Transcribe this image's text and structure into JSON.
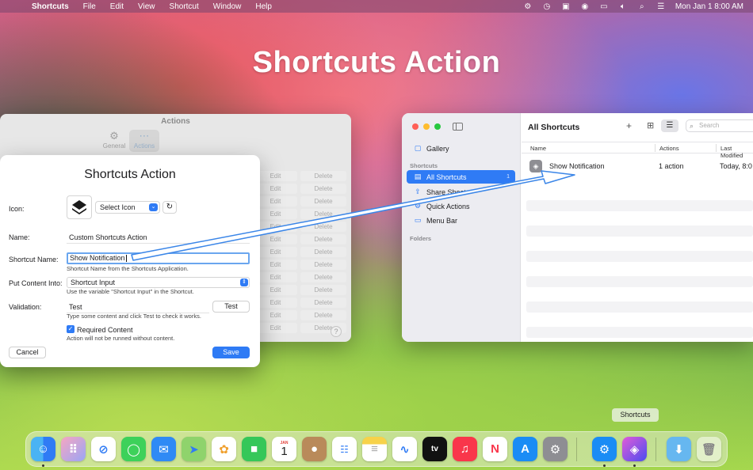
{
  "menubar": {
    "app_name": "Shortcuts",
    "items": [
      "File",
      "Edit",
      "View",
      "Shortcut",
      "Window",
      "Help"
    ],
    "clock": "Mon Jan 1  8:00 AM"
  },
  "overlay_title": "Shortcuts Action",
  "settings_window": {
    "title": "Actions",
    "tabs": [
      "General",
      "Actions"
    ],
    "edit_label": "Edit",
    "delete_label": "Delete",
    "help": "?"
  },
  "dialog": {
    "title": "Shortcuts Action",
    "icon_label": "Icon:",
    "select_icon": "Select Icon",
    "name_label": "Name:",
    "name_value": "Custom Shortcuts Action",
    "shortcut_name_label": "Shortcut Name:",
    "shortcut_name_value": "Show Notification",
    "shortcut_name_hint": "Shortcut Name from the Shortcuts Application.",
    "put_content_label": "Put Content Into:",
    "put_content_value": "Shortcut Input",
    "put_content_hint": "Use the variable \"Shortcut Input\" in the Shortcut.",
    "validation_label": "Validation:",
    "validation_value": "Test",
    "test_button": "Test",
    "validation_hint": "Type some content and click Test to check it works.",
    "required_label": "Required Content",
    "required_hint": "Action will not be runned without content.",
    "cancel_button": "Cancel",
    "save_button": "Save"
  },
  "shortcuts_app": {
    "sidebar": {
      "gallery": "Gallery",
      "section_shortcuts": "Shortcuts",
      "items": [
        {
          "label": "All Shortcuts",
          "count": "1"
        },
        {
          "label": "Share Sheet"
        },
        {
          "label": "Quick Actions"
        },
        {
          "label": "Menu Bar"
        }
      ],
      "section_folders": "Folders"
    },
    "main_title": "All Shortcuts",
    "search_placeholder": "Search",
    "columns": [
      "Name",
      "Actions",
      "Last Modified"
    ],
    "rows": [
      {
        "name": "Show Notification",
        "actions": "1 action",
        "modified": "Today, 8:0"
      }
    ]
  },
  "dock": {
    "tooltip": "Shortcuts",
    "calendar_month": "JAN",
    "calendar_day": "1",
    "tv_label": "tv"
  },
  "colors": {
    "accent": "#2f7bf5",
    "arrow": "#3b86e8"
  }
}
